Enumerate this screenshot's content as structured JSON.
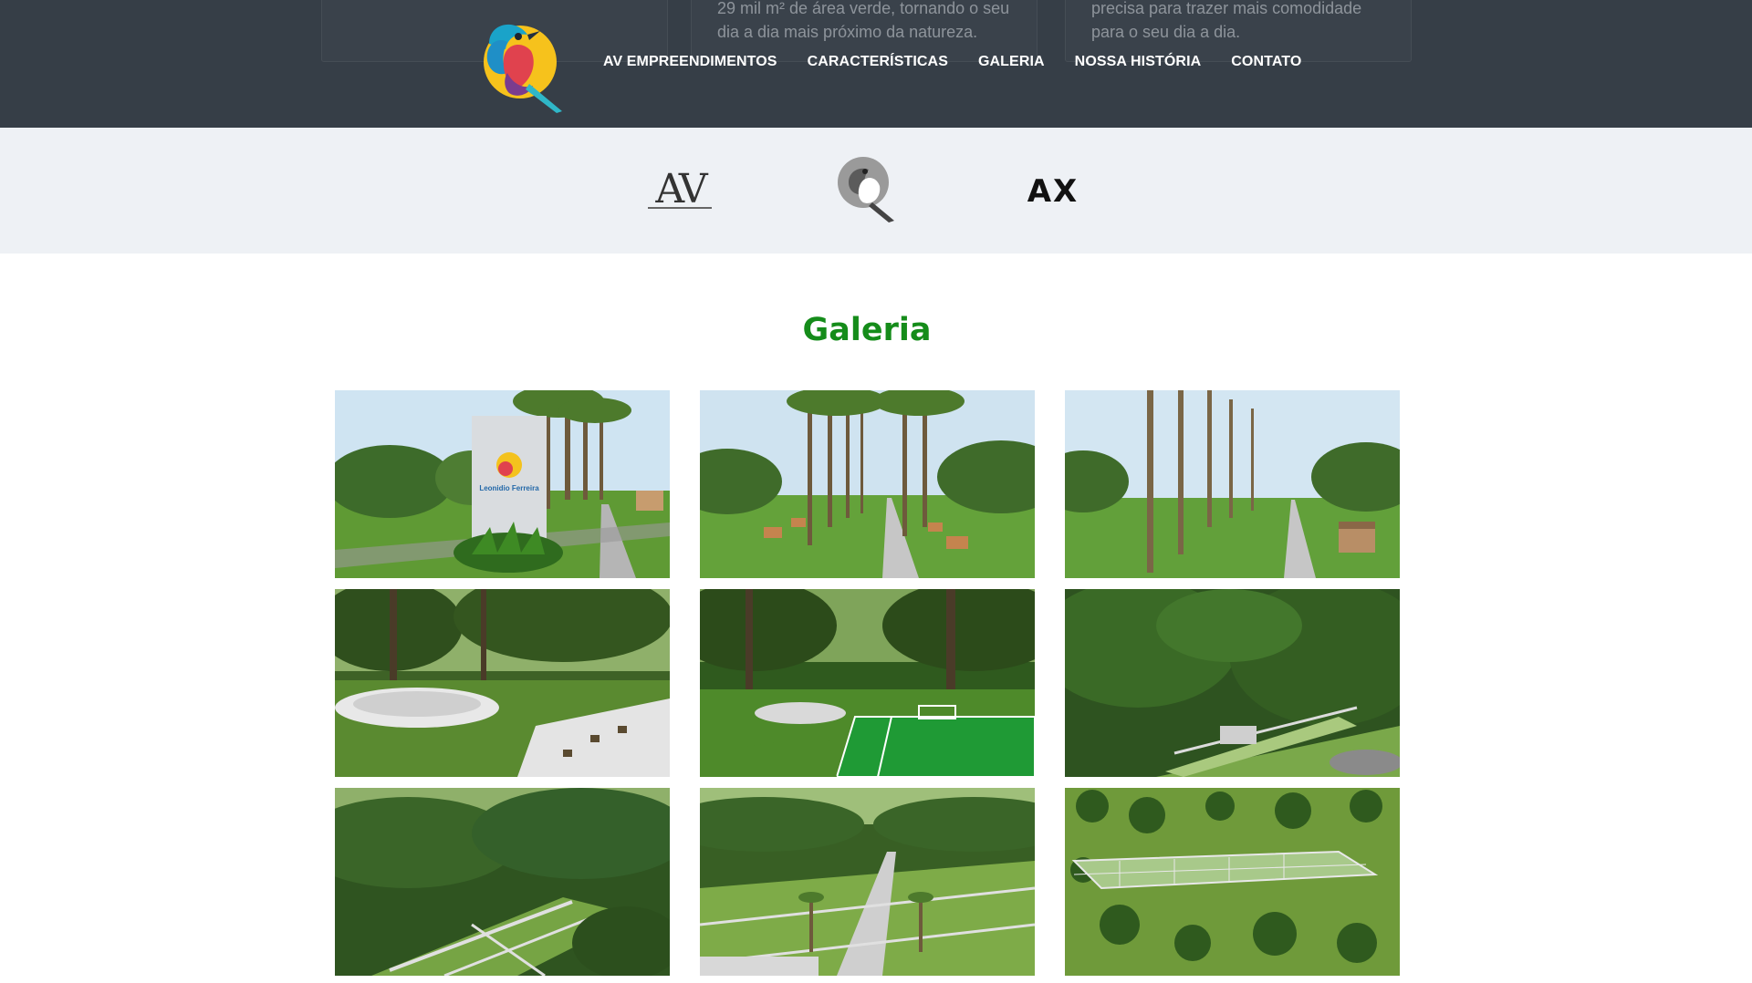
{
  "header": {
    "bg_color": "#363e47",
    "faded_text_1": [
      "29 mil m² de área verde, tornando o seu",
      "dia a dia mais próximo da natureza."
    ],
    "faded_text_2": [
      "precisa para trazer mais comodidade",
      "para o seu dia a dia."
    ],
    "logo_icon": "bird-logo-icon"
  },
  "nav": {
    "items": [
      {
        "label": "AV EMPREENDIMENTOS"
      },
      {
        "label": "CARACTERÍSTICAS"
      },
      {
        "label": "GALERIA"
      },
      {
        "label": "NOSSA HISTÓRIA"
      },
      {
        "label": "CONTATO"
      }
    ]
  },
  "partners": {
    "items": [
      {
        "name": "av-logo",
        "text": "AV"
      },
      {
        "name": "bird-grey-logo",
        "text": ""
      },
      {
        "name": "ax-logo",
        "text": "AX"
      }
    ]
  },
  "gallery": {
    "title": "Galeria",
    "title_color": "#158c1a",
    "images": [
      {
        "kind": "entrance-sign",
        "sign_text": "Leonidio Ferreira"
      },
      {
        "kind": "palm-avenue"
      },
      {
        "kind": "palm-avenue-close"
      },
      {
        "kind": "plaza"
      },
      {
        "kind": "soccer-field"
      },
      {
        "kind": "aerial-park"
      },
      {
        "kind": "aerial-lots"
      },
      {
        "kind": "aerial-avenue"
      },
      {
        "kind": "top-view"
      }
    ]
  }
}
